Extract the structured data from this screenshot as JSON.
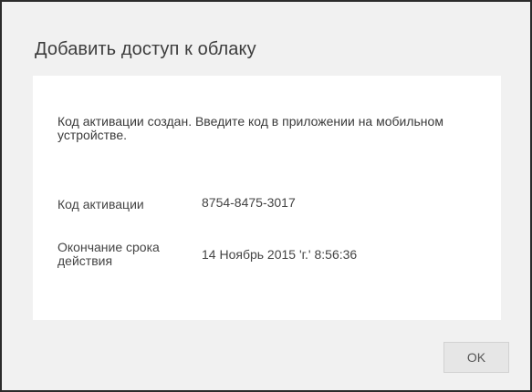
{
  "dialog": {
    "title": "Добавить доступ к облаку",
    "message": "Код активации создан. Введите код в приложении на мобильном устройстве.",
    "activation_code": {
      "label": "Код активации",
      "value": "8754-8475-3017"
    },
    "expiration": {
      "label": "Окончание срока действия",
      "value": "14 Ноябрь 2015 'г.' 8:56:36"
    },
    "ok_label": "OK"
  }
}
